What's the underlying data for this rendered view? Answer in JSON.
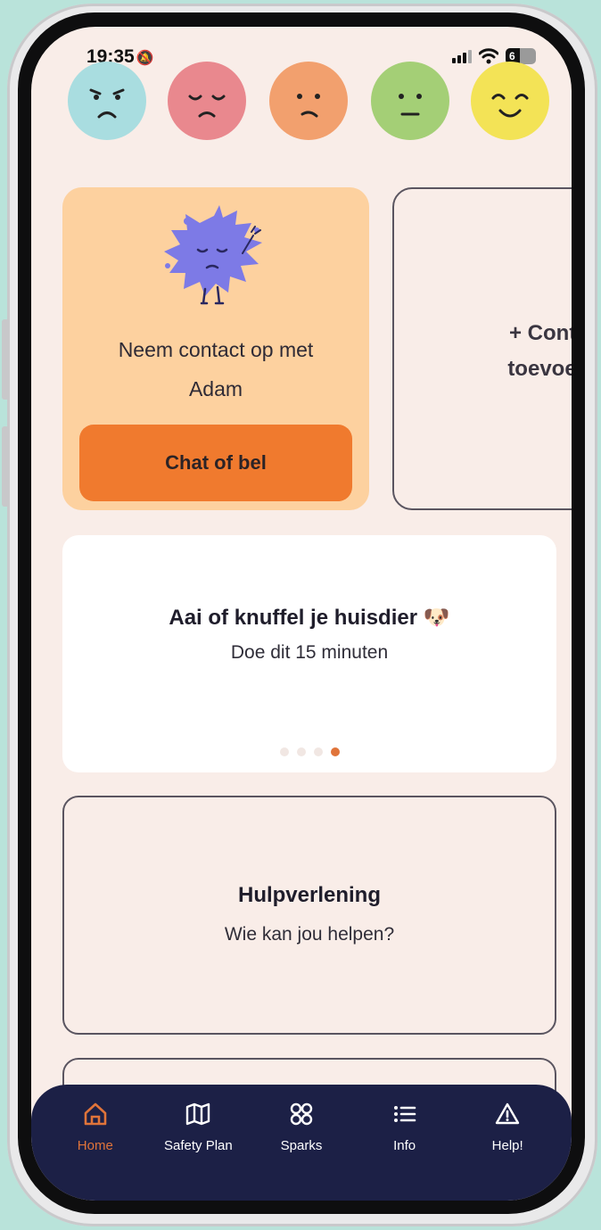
{
  "status_bar": {
    "time": "19:35",
    "battery": "6"
  },
  "moods": [
    {
      "name": "very-upset",
      "color": "#a9dde0"
    },
    {
      "name": "sad",
      "color": "#e9888e"
    },
    {
      "name": "worried",
      "color": "#f2a06e"
    },
    {
      "name": "neutral",
      "color": "#a4cf76"
    },
    {
      "name": "happy",
      "color": "#f3e356"
    }
  ],
  "contact_card": {
    "text": "Neem contact op met",
    "name": "Adam",
    "button": "Chat of bel"
  },
  "add_contact_card": {
    "line1": "+ Contac",
    "line2": "toevoege"
  },
  "spark": {
    "title": "Aai of knuffel je huisdier",
    "emoji": "🐶",
    "subtitle": "Doe dit 15 minuten",
    "dots": 4,
    "active_dot": 4
  },
  "help_card": {
    "title": "Hulpverlening",
    "subtitle": "Wie kan jou helpen?"
  },
  "nav": [
    {
      "label": "Home",
      "icon": "home-icon",
      "active": true
    },
    {
      "label": "Safety Plan",
      "icon": "map-icon",
      "active": false
    },
    {
      "label": "Sparks",
      "icon": "grid-icon",
      "active": false
    },
    {
      "label": "Info",
      "icon": "list-icon",
      "active": false
    },
    {
      "label": "Help!",
      "icon": "warning-icon",
      "active": false
    }
  ],
  "colors": {
    "accent": "#e0743a",
    "nav_bg": "#1c2046",
    "background": "#f9ede8"
  }
}
